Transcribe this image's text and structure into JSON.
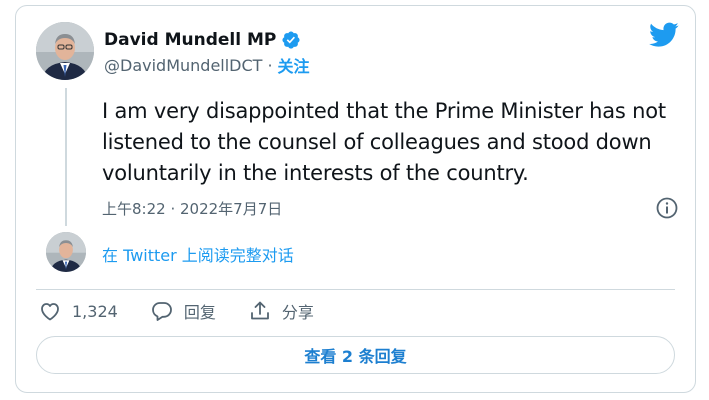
{
  "author": {
    "display_name": "David Mundell MP",
    "handle": "@DavidMundellDCT",
    "separator": "·",
    "follow_label": "关注",
    "verified": true
  },
  "tweet": {
    "text": "I am very disappointed that the Prime Minister has not listened to the counsel of colleagues and stood down voluntarily in the interests of the country.",
    "timestamp": "上午8:22 · 2022年7月7日"
  },
  "thread": {
    "read_on_twitter": "在 Twitter 上阅读完整对话"
  },
  "actions": {
    "like_count": "1,324",
    "reply_label": "回复",
    "share_label": "分享"
  },
  "footer": {
    "view_replies": "查看 2 条回复"
  },
  "icons": {
    "brand": "twitter-bird-icon",
    "verified": "verified-badge-icon",
    "info": "info-icon",
    "like": "heart-icon",
    "reply": "speech-bubble-icon",
    "share": "share-upload-icon"
  },
  "colors": {
    "accent": "#1d9bf0",
    "text": "#0f1419",
    "secondary": "#536471",
    "border": "#cfd9de"
  }
}
